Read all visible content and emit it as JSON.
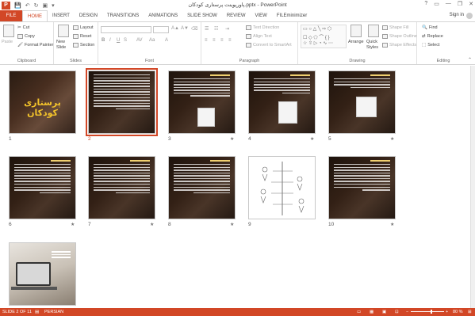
{
  "title_bar": {
    "document_title": "پاورپوینت پرستاری کودکان.pptx - PowerPoint",
    "app_icon": "P",
    "help": "?",
    "minimize": "—",
    "restore": "❐",
    "close": "✕"
  },
  "tabs": [
    "FILE",
    "HOME",
    "INSERT",
    "DESIGN",
    "TRANSITIONS",
    "ANIMATIONS",
    "SLIDE SHOW",
    "REVIEW",
    "VIEW",
    "FILEminimizer"
  ],
  "active_tab": "HOME",
  "sign_in": "Sign in",
  "ribbon": {
    "clipboard": {
      "paste": "Paste",
      "cut": "Cut",
      "copy": "Copy",
      "format_painter": "Format Painter",
      "label": "Clipboard"
    },
    "slides": {
      "new_slide": "New Slide",
      "layout": "Layout",
      "reset": "Reset",
      "section": "Section",
      "label": "Slides"
    },
    "font": {
      "label": "Font"
    },
    "paragraph": {
      "text_direction": "Text Direction",
      "align_text": "Align Text",
      "convert": "Convert to SmartArt",
      "label": "Paragraph"
    },
    "drawing": {
      "arrange": "Arrange",
      "quick_styles": "Quick Styles",
      "shape_fill": "Shape Fill",
      "shape_outline": "Shape Outline",
      "shape_effects": "Shape Effects",
      "label": "Drawing"
    },
    "editing": {
      "find": "Find",
      "replace": "Replace",
      "select": "Select",
      "label": "Editing"
    }
  },
  "slides": {
    "title_text": "پرستاری کودکان",
    "numbers": [
      "1",
      "2",
      "3",
      "4",
      "5",
      "6",
      "7",
      "8",
      "9",
      "10",
      "11"
    ],
    "selected": "2",
    "star": "★"
  },
  "status": {
    "slide_info": "SLIDE 2 OF 11",
    "language": "PERSIAN",
    "zoom": "80 %"
  }
}
